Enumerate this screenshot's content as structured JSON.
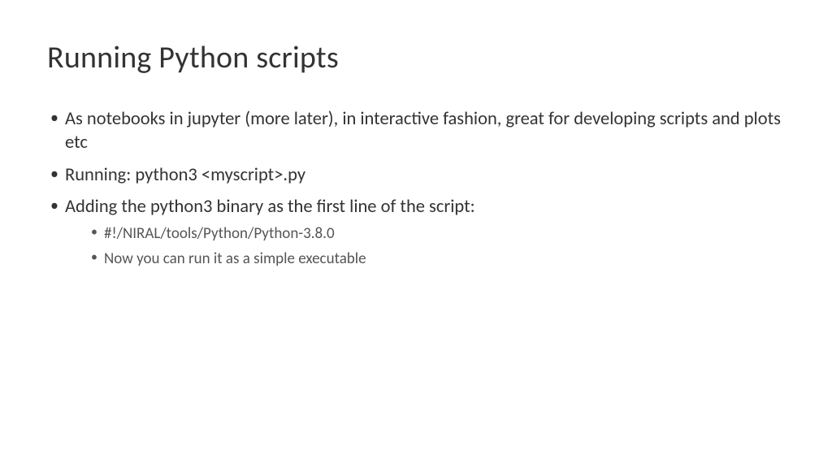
{
  "title": "Running Python scripts",
  "bullets": [
    {
      "text": "As notebooks in jupyter (more later), in interactive fashion, great for developing scripts and plots etc"
    },
    {
      "text": "Running: python3 <myscript>.py"
    },
    {
      "text": "Adding the python3 binary as the first line of the script:",
      "sub": [
        "#!/NIRAL/tools/Python/Python-3.8.0",
        "Now you can run it as a simple executable"
      ]
    }
  ]
}
